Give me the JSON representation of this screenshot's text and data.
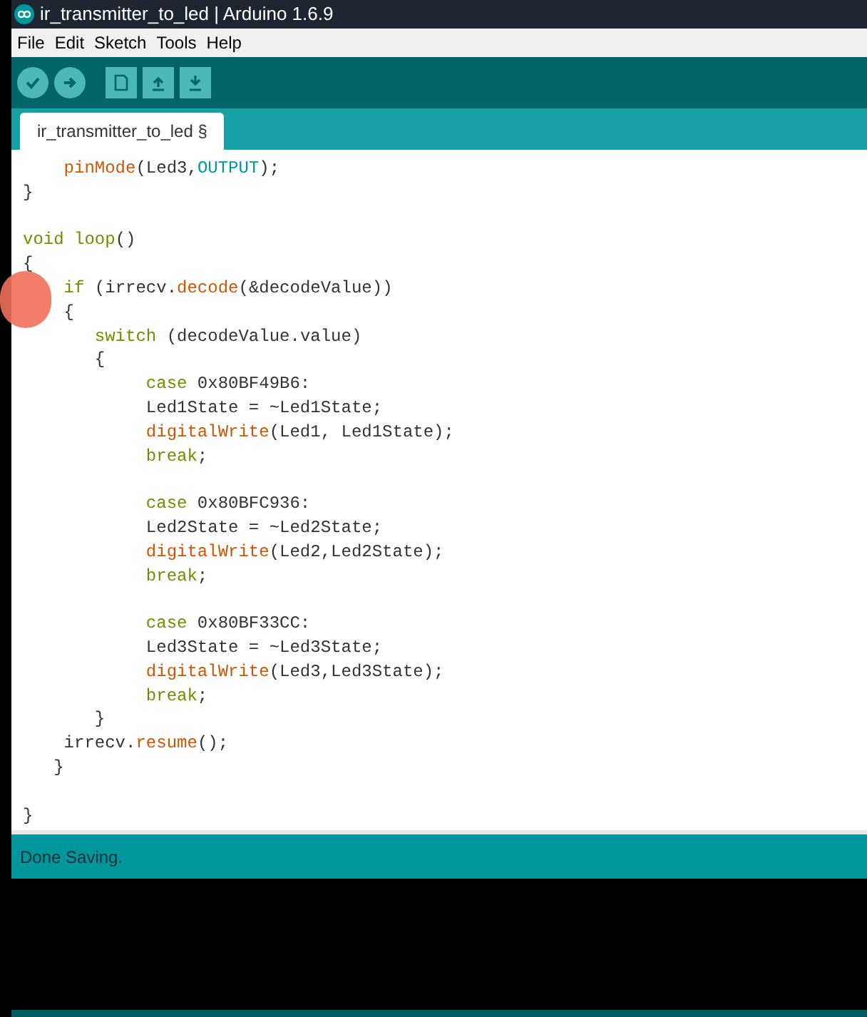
{
  "window": {
    "title": "ir_transmitter_to_led | Arduino 1.6.9"
  },
  "menu": [
    "File",
    "Edit",
    "Sketch",
    "Tools",
    "Help"
  ],
  "tabs": [
    {
      "label": "ir_transmitter_to_led §",
      "selected": true
    }
  ],
  "code_lines": [
    {
      "kind": "code",
      "tokens": [
        {
          "text": "    pinMode",
          "kind": "function"
        },
        {
          "text": "(Led3,"
        },
        {
          "text": "OUTPUT",
          "kind": "constant"
        },
        {
          "text": ");"
        }
      ]
    },
    {
      "kind": "code",
      "tokens": [
        {
          "text": "}"
        }
      ]
    },
    {
      "kind": "blank"
    },
    {
      "kind": "code",
      "tokens": [
        {
          "text": "void ",
          "kind": "keyword"
        },
        {
          "text": "loop",
          "kind": "keyword"
        },
        {
          "text": "()"
        }
      ]
    },
    {
      "kind": "code",
      "tokens": [
        {
          "text": "{"
        }
      ]
    },
    {
      "kind": "code",
      "tokens": [
        {
          "text": "    if",
          "kind": "keyword"
        },
        {
          "text": " (irrecv."
        },
        {
          "text": "decode",
          "kind": "function"
        },
        {
          "text": "(&decodeValue))"
        }
      ]
    },
    {
      "kind": "code",
      "tokens": [
        {
          "text": "    {"
        }
      ]
    },
    {
      "kind": "code",
      "tokens": [
        {
          "text": "       switch",
          "kind": "keyword"
        },
        {
          "text": " (decodeValue.value)"
        }
      ]
    },
    {
      "kind": "code",
      "tokens": [
        {
          "text": "       {"
        }
      ]
    },
    {
      "kind": "code",
      "tokens": [
        {
          "text": "            case",
          "kind": "keyword"
        },
        {
          "text": " 0x80BF49B6:"
        }
      ]
    },
    {
      "kind": "code",
      "tokens": [
        {
          "text": "            Led1State = ~Led1State;"
        }
      ]
    },
    {
      "kind": "code",
      "tokens": [
        {
          "text": "            digitalWrite",
          "kind": "function"
        },
        {
          "text": "(Led1, Led1State);"
        }
      ]
    },
    {
      "kind": "code",
      "tokens": [
        {
          "text": "            break",
          "kind": "keyword"
        },
        {
          "text": ";"
        }
      ]
    },
    {
      "kind": "blank"
    },
    {
      "kind": "code",
      "tokens": [
        {
          "text": "            case",
          "kind": "keyword"
        },
        {
          "text": " 0x80BFC936:"
        }
      ]
    },
    {
      "kind": "code",
      "tokens": [
        {
          "text": "            Led2State = ~Led2State;"
        }
      ]
    },
    {
      "kind": "code",
      "tokens": [
        {
          "text": "            digitalWrite",
          "kind": "function"
        },
        {
          "text": "(Led2,Led2State);"
        }
      ]
    },
    {
      "kind": "code",
      "tokens": [
        {
          "text": "            break",
          "kind": "keyword"
        },
        {
          "text": ";"
        }
      ]
    },
    {
      "kind": "blank"
    },
    {
      "kind": "code",
      "tokens": [
        {
          "text": "            case",
          "kind": "keyword"
        },
        {
          "text": " 0x80BF33CC:"
        }
      ]
    },
    {
      "kind": "code",
      "tokens": [
        {
          "text": "            Led3State = ~Led3State;"
        }
      ]
    },
    {
      "kind": "code",
      "tokens": [
        {
          "text": "            digitalWrite",
          "kind": "function"
        },
        {
          "text": "(Led3,Led3State);"
        }
      ]
    },
    {
      "kind": "code",
      "tokens": [
        {
          "text": "            break",
          "kind": "keyword"
        },
        {
          "text": ";"
        }
      ]
    },
    {
      "kind": "code",
      "tokens": [
        {
          "text": "       }"
        }
      ]
    },
    {
      "kind": "code",
      "tokens": [
        {
          "text": "    irrecv."
        },
        {
          "text": "resume",
          "kind": "function"
        },
        {
          "text": "();"
        }
      ]
    },
    {
      "kind": "code",
      "tokens": [
        {
          "text": "   }"
        }
      ]
    },
    {
      "kind": "blank"
    },
    {
      "kind": "code",
      "tokens": [
        {
          "text": "}"
        }
      ]
    }
  ],
  "status_bar": {
    "message": "Done Saving."
  }
}
